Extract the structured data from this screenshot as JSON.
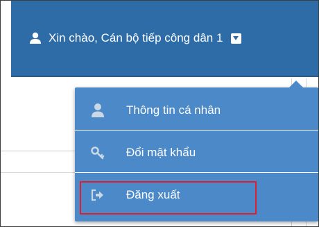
{
  "header": {
    "greeting": "Xin chào, Cán bộ tiếp công dân 1",
    "user_icon": "user-icon",
    "caret_icon": "caret-down-icon"
  },
  "dropdown": {
    "items": [
      {
        "label": "Thông tin cá nhân",
        "icon": "user-icon"
      },
      {
        "label": "Đổi mật khẩu",
        "icon": "key-icon"
      },
      {
        "label": "Đăng xuất",
        "icon": "sign-out-icon"
      }
    ],
    "highlighted_item": "Đăng xuất"
  },
  "colors": {
    "header_bg": "#2e6ca8",
    "dropdown_bg": "#4c89c8",
    "highlight_border": "#e01e2c"
  }
}
